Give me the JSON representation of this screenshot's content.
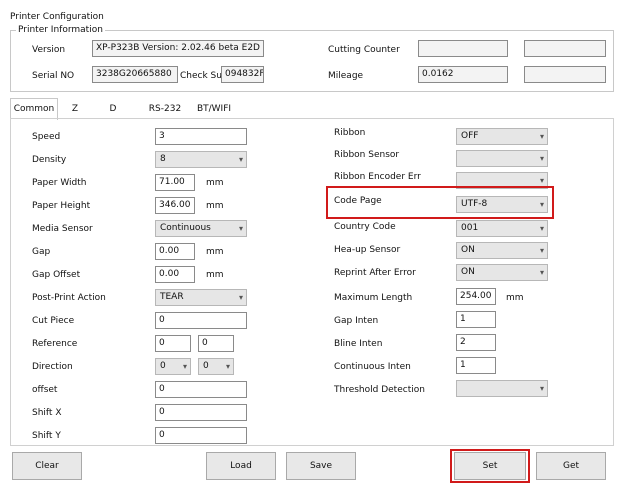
{
  "window": {
    "title": "Printer Configuration"
  },
  "printer_info": {
    "group_label": "Printer Information",
    "version_label": "Version",
    "version_value": "XP-P323B Version: 2.02.46 beta E2D",
    "serial_label": "Serial NO",
    "serial_value": "3238G20665880",
    "checksum_label": "Check Sum",
    "checksum_value": "094832FE",
    "cutting_counter_label": "Cutting Counter",
    "cutting_counter_value": "",
    "cutting_counter_value2": "",
    "mileage_label": "Mileage",
    "mileage_value": "0.0162",
    "mileage_value2": ""
  },
  "tabs": [
    "Common",
    "Z",
    "D",
    "RS-232",
    "BT/WIFI"
  ],
  "common": {
    "left": {
      "speed_label": "Speed",
      "speed_value": "3",
      "density_label": "Density",
      "density_value": "8",
      "paper_width_label": "Paper Width",
      "paper_width_value": "71.00",
      "paper_width_unit": "mm",
      "paper_height_label": "Paper Height",
      "paper_height_value": "346.00",
      "paper_height_unit": "mm",
      "media_sensor_label": "Media Sensor",
      "media_sensor_value": "Continuous",
      "gap_label": "Gap",
      "gap_value": "0.00",
      "gap_unit": "mm",
      "gap_offset_label": "Gap Offset",
      "gap_offset_value": "0.00",
      "gap_offset_unit": "mm",
      "post_print_label": "Post-Print Action",
      "post_print_value": "TEAR",
      "cut_piece_label": "Cut Piece",
      "cut_piece_value": "0",
      "reference_label": "Reference",
      "reference_x": "0",
      "reference_y": "0",
      "direction_label": "Direction",
      "direction_a": "0",
      "direction_b": "0",
      "offset_label": "offset",
      "offset_value": "0",
      "shift_x_label": "Shift X",
      "shift_x_value": "0",
      "shift_y_label": "Shift Y",
      "shift_y_value": "0"
    },
    "right": {
      "ribbon_label": "Ribbon",
      "ribbon_value": "OFF",
      "ribbon_sensor_label": "Ribbon  Sensor",
      "ribbon_sensor_value": "",
      "ribbon_encoder_label": "Ribbon Encoder Err",
      "ribbon_encoder_value": "",
      "code_page_label": "Code Page",
      "code_page_value": "UTF-8",
      "country_code_label": "Country Code",
      "country_code_value": "001",
      "head_up_label": "Hea-up  Sensor",
      "head_up_value": "ON",
      "reprint_label": "Reprint After  Error",
      "reprint_value": "ON",
      "max_length_label": "Maximum Length",
      "max_length_value": "254.00",
      "max_length_unit": "mm",
      "gap_inten_label": "Gap Inten",
      "gap_inten_value": "1",
      "bline_inten_label": "Bline  Inten",
      "bline_inten_value": "2",
      "cont_inten_label": "Continuous  Inten",
      "cont_inten_value": "1",
      "threshold_label": "Threshold  Detection",
      "threshold_value": ""
    }
  },
  "buttons": {
    "clear": "Clear",
    "load": "Load",
    "save": "Save",
    "set": "Set",
    "get": "Get"
  },
  "icons": {
    "dropdown": "▾"
  },
  "colors": {
    "highlight": "#d11a1a"
  }
}
